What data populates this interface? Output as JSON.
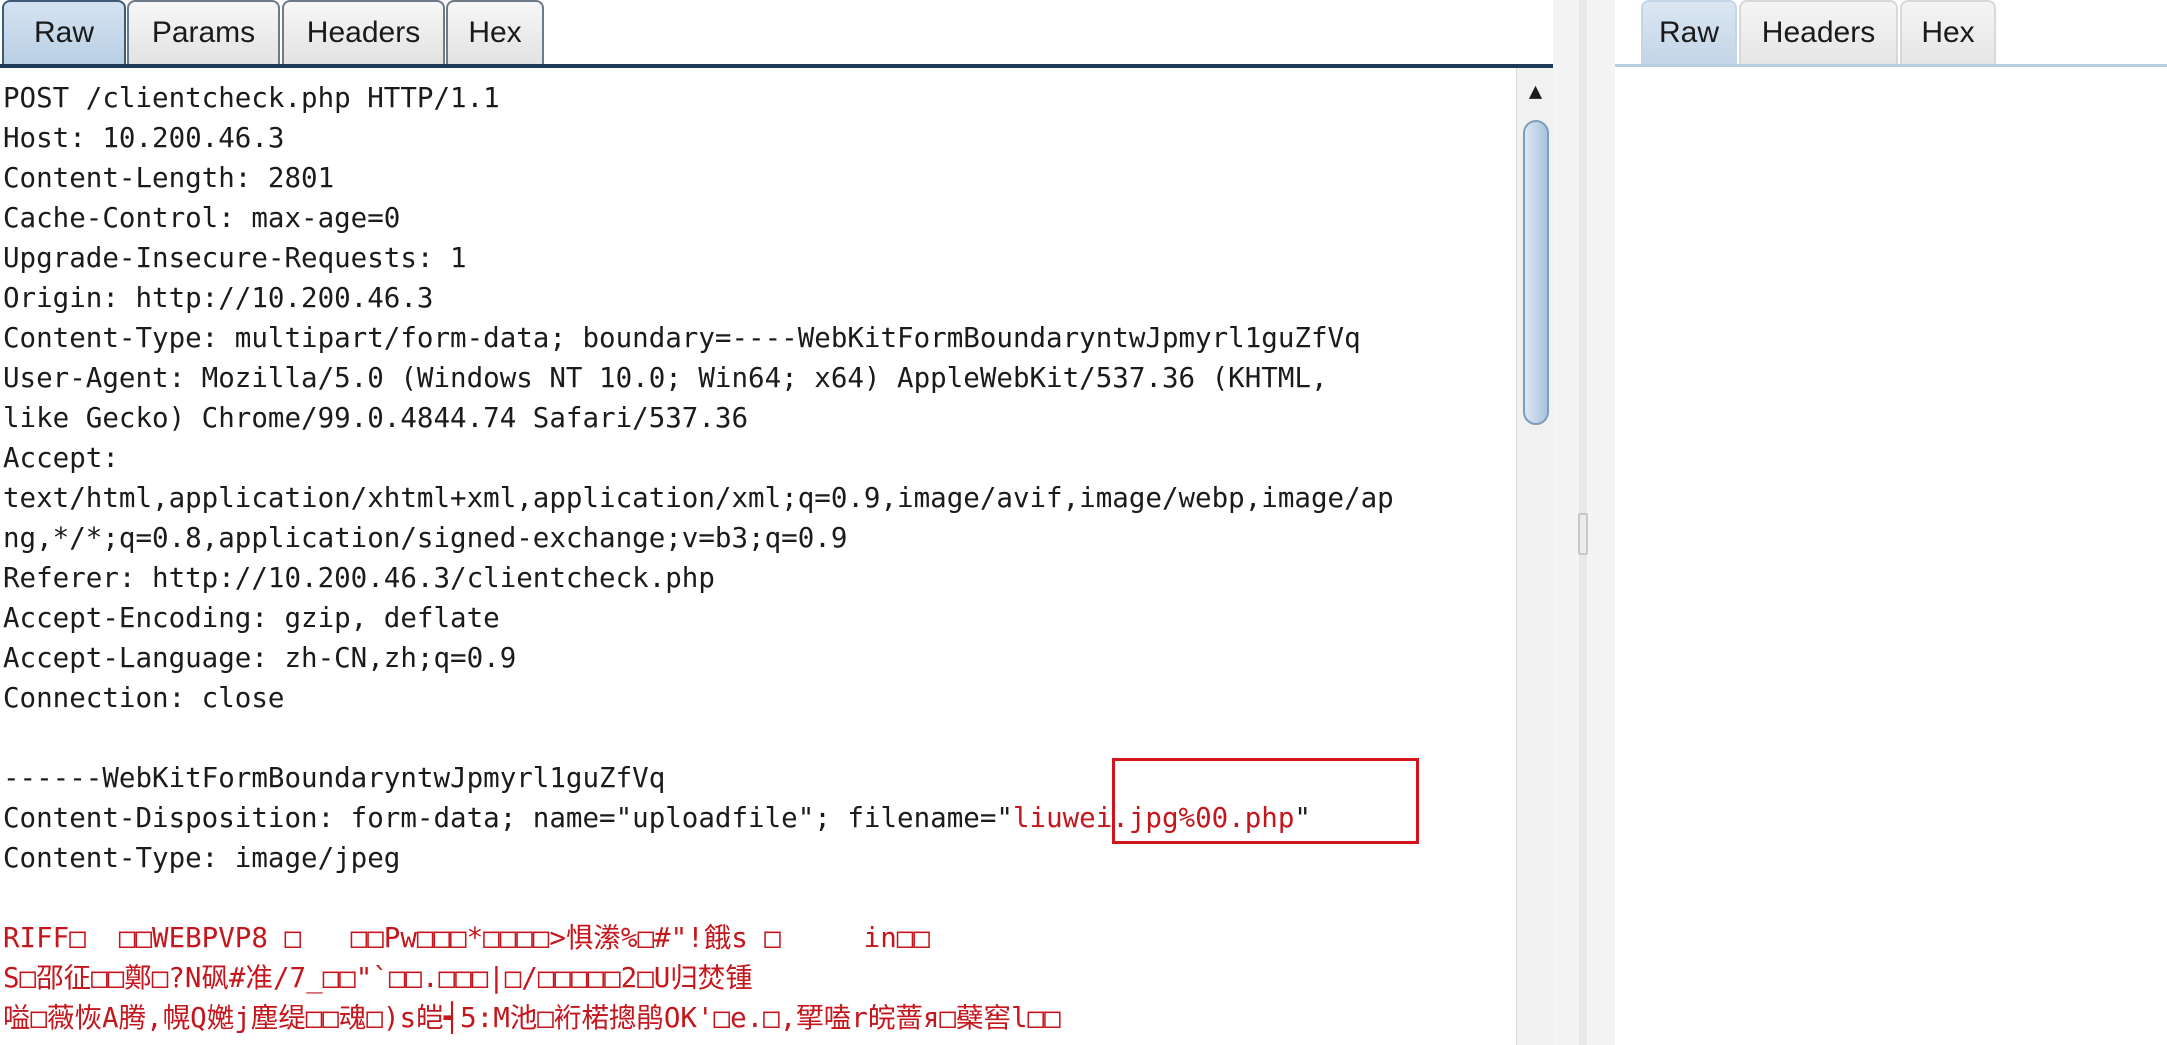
{
  "request_tabs": [
    "Raw",
    "Params",
    "Headers",
    "Hex"
  ],
  "response_tabs": [
    "Raw",
    "Headers",
    "Hex"
  ],
  "request_lines": [
    "POST /clientcheck.php HTTP/1.1",
    "Host: 10.200.46.3",
    "Content-Length: 2801",
    "Cache-Control: max-age=0",
    "Upgrade-Insecure-Requests: 1",
    "Origin: http://10.200.46.3",
    "Content-Type: multipart/form-data; boundary=----WebKitFormBoundaryntwJpmyrl1guZfVq",
    "User-Agent: Mozilla/5.0 (Windows NT 10.0; Win64; x64) AppleWebKit/537.36 (KHTML,",
    "like Gecko) Chrome/99.0.4844.74 Safari/537.36",
    "Accept:",
    "text/html,application/xhtml+xml,application/xml;q=0.9,image/avif,image/webp,image/ap",
    "ng,*/*;q=0.8,application/signed-exchange;v=b3;q=0.9",
    "Referer: http://10.200.46.3/clientcheck.php",
    "Accept-Encoding: gzip, deflate",
    "Accept-Language: zh-CN,zh;q=0.9",
    "Connection: close",
    "",
    "------WebKitFormBoundaryntwJpmyrl1guZfVq"
  ],
  "disposition": {
    "prefix": "Content-Disposition: form-data; name=\"uploadfile\"; filename=\"",
    "filename": "liuwei.jpg%00.php",
    "suffix": "\""
  },
  "content_type_line": "Content-Type: image/jpeg",
  "binary_lines": [
    "RIFF□  □□WEBPVP8 □   □□Pw□□□*□□□□>惧潫%□#\"!餓s □     in□□",
    "S□邵征□□鄭□?N砜#准/7_□□\"`□□.□□□|□/□□□□□2□U归焚锺",
    "嗌□薇恢A腾,幌Q嬔j塵缇□□魂□)s皑┥5:M池□裄楉摠鹃OK'□e.□,揅嗑r皖蔷я□蘗窖l□□"
  ],
  "colors": {
    "tab_underline": "#1f3a56",
    "active_tab": "#c4d7ea",
    "highlight_box": "#d4141c",
    "binary_text": "#c4161c",
    "scroll_thumb": "#a9c3de"
  },
  "icons": {
    "scroll_up": "▲"
  }
}
